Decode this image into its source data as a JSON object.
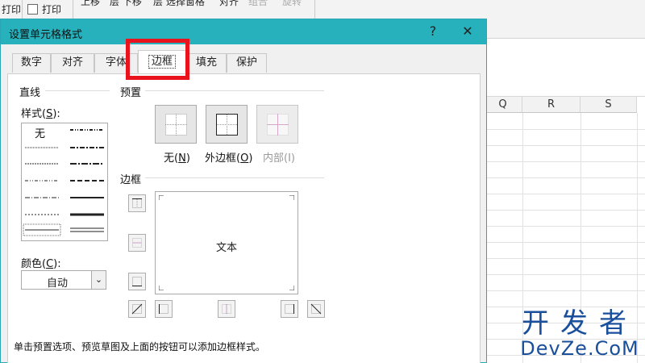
{
  "ribbon": {
    "items": [
      {
        "label": "打印",
        "checkbox": true
      },
      {
        "label": "上移"
      },
      {
        "label": "层 下移"
      },
      {
        "label": "层 选择窗格"
      },
      {
        "label": "对齐"
      },
      {
        "label": "组合",
        "disabled": true
      },
      {
        "label": "旋转",
        "disabled": true
      }
    ]
  },
  "sheet": {
    "columns": [
      "Q",
      "R",
      "S"
    ]
  },
  "watermark": {
    "line1": "开发者",
    "line2": "DevZe.CoM"
  },
  "dialog": {
    "title": "设置单元格格式",
    "help_label": "?",
    "close_label": "✕",
    "tabs": [
      {
        "label": "数字"
      },
      {
        "label": "对齐"
      },
      {
        "label": "字体"
      },
      {
        "label": "边框",
        "active": true
      },
      {
        "label": "填充"
      },
      {
        "label": "保护"
      }
    ],
    "line_section": {
      "heading": "直线",
      "style_label": "样式(",
      "style_key": "S",
      "style_suffix": "):",
      "none_label": "无",
      "color_label": "颜色(",
      "color_key": "C",
      "color_suffix": "):",
      "color_value": "自动"
    },
    "presets_section": {
      "heading": "预置",
      "none": {
        "label": "无(",
        "key": "N",
        "suffix": ")"
      },
      "outline": {
        "label": "外边框(",
        "key": "O",
        "suffix": ")"
      },
      "inside": {
        "label": "内部(I)"
      }
    },
    "border_section": {
      "heading": "边框",
      "preview_text": "文本"
    },
    "hint": "单击预置选项、预览草图及上面的按钮可以添加边框样式。"
  },
  "colors": {
    "titlebar": "#26b1bc",
    "highlight": "#e8131d",
    "watermark": "#1a4f9c"
  }
}
